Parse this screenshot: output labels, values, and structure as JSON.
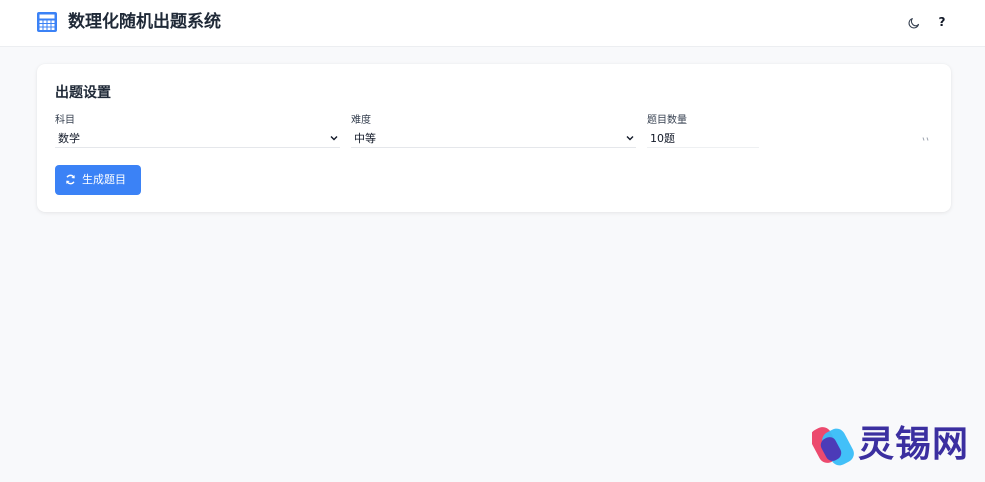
{
  "header": {
    "title": "数理化随机出题系统",
    "logo_icon": "calculator-icon",
    "theme_icon": "moon-icon",
    "help_label": "?"
  },
  "settings": {
    "title": "出题设置",
    "subject": {
      "label": "科目",
      "value": "数学"
    },
    "difficulty": {
      "label": "难度",
      "value": "中等"
    },
    "count": {
      "label": "题目数量",
      "value": "10题"
    },
    "generate_button": {
      "label": "生成题目",
      "icon": "refresh-icon"
    }
  },
  "watermark": {
    "text": "灵锡网"
  },
  "colors": {
    "primary": "#3b82f6",
    "background": "#f8f9fb",
    "card": "#ffffff",
    "text": "#1f2937"
  }
}
